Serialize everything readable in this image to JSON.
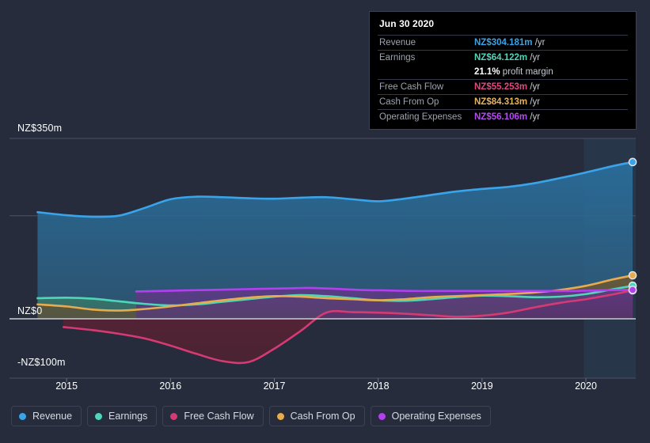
{
  "tooltip": {
    "date": "Jun 30 2020",
    "rows": [
      {
        "key": "Revenue",
        "value": "NZ$304.181m",
        "unit": "/yr",
        "color": "#3aa4ea"
      },
      {
        "key": "Earnings",
        "value": "NZ$64.122m",
        "unit": "/yr",
        "color": "#4fd6b8"
      },
      {
        "key": "",
        "value": "21.1%",
        "unit": "profit margin",
        "color": "#ffffff"
      },
      {
        "key": "Free Cash Flow",
        "value": "NZ$55.253m",
        "unit": "/yr",
        "color": "#e0487f"
      },
      {
        "key": "Cash From Op",
        "value": "NZ$84.313m",
        "unit": "/yr",
        "color": "#e8b45a"
      },
      {
        "key": "Operating Expenses",
        "value": "NZ$56.106m",
        "unit": "/yr",
        "color": "#b44bf0"
      }
    ]
  },
  "legend": {
    "items": [
      {
        "label": "Revenue",
        "color": "#3aa4ea"
      },
      {
        "label": "Earnings",
        "color": "#4fd6b8"
      },
      {
        "label": "Free Cash Flow",
        "color": "#d63a74"
      },
      {
        "label": "Cash From Op",
        "color": "#e8ab4e"
      },
      {
        "label": "Operating Expenses",
        "color": "#b33ff0"
      }
    ]
  },
  "chart_data": {
    "type": "area",
    "title": "",
    "xlabel": "",
    "ylabel": "",
    "currency": "NZ$",
    "units": "millions per year",
    "grid": true,
    "legend_position": "bottom-left",
    "ylim": [
      -100,
      350
    ],
    "ytick_labels": [
      "NZ$350m",
      "NZ$0",
      "-NZ$100m"
    ],
    "ytick_values": [
      350,
      0,
      -100
    ],
    "gridline_values": [
      350,
      200,
      0,
      -100
    ],
    "xtick_labels": [
      "2015",
      "2016",
      "2017",
      "2018",
      "2019",
      "2020"
    ],
    "xlim": [
      2014.45,
      2020.48
    ],
    "highlight_band": {
      "from": 2019.98,
      "to": 2020.48,
      "label": "forecast-period"
    },
    "series": [
      {
        "name": "Revenue",
        "color": "#3aa4ea",
        "fill": "#1d5580",
        "x": [
          2014.72,
          2015.0,
          2015.25,
          2015.5,
          2015.75,
          2016.0,
          2016.25,
          2016.5,
          2016.75,
          2017.0,
          2017.25,
          2017.5,
          2017.75,
          2018.0,
          2018.25,
          2018.5,
          2018.75,
          2019.0,
          2019.25,
          2019.5,
          2019.75,
          2020.0,
          2020.25,
          2020.45
        ],
        "y": [
          207,
          201,
          198,
          200,
          215,
          232,
          237,
          236,
          234,
          233,
          235,
          236,
          232,
          228,
          233,
          240,
          247,
          252,
          256,
          263,
          273,
          284,
          296,
          304.181
        ]
      },
      {
        "name": "Earnings",
        "color": "#4fd6b8",
        "fill": "#2e7a6c",
        "x": [
          2014.72,
          2015.0,
          2015.25,
          2015.5,
          2015.75,
          2016.0,
          2016.25,
          2016.5,
          2016.75,
          2017.0,
          2017.25,
          2017.5,
          2017.75,
          2018.0,
          2018.25,
          2018.5,
          2018.75,
          2019.0,
          2019.25,
          2019.5,
          2019.75,
          2020.0,
          2020.25,
          2020.45
        ],
        "y": [
          40,
          41,
          39,
          34,
          29,
          26,
          28,
          33,
          38,
          43,
          46,
          44,
          40,
          36,
          35,
          38,
          42,
          45,
          44,
          42,
          43,
          48,
          57,
          64.122
        ]
      },
      {
        "name": "Free Cash Flow",
        "color": "#d63a74",
        "fill": "#5c2437",
        "x": [
          2014.97,
          2015.25,
          2015.5,
          2015.75,
          2016.0,
          2016.25,
          2016.5,
          2016.75,
          2017.0,
          2017.25,
          2017.5,
          2017.75,
          2018.0,
          2018.25,
          2018.5,
          2018.75,
          2019.0,
          2019.25,
          2019.5,
          2019.75,
          2020.0,
          2020.25,
          2020.45
        ],
        "y": [
          -16,
          -22,
          -29,
          -38,
          -52,
          -68,
          -82,
          -84,
          -58,
          -24,
          12,
          13,
          12,
          10,
          7,
          4,
          6,
          12,
          22,
          31,
          38,
          47,
          55.253
        ]
      },
      {
        "name": "Cash From Op",
        "color": "#e8ab4e",
        "fill": "#6d5a3a",
        "x": [
          2014.72,
          2015.0,
          2015.25,
          2015.5,
          2015.75,
          2016.0,
          2016.25,
          2016.5,
          2016.75,
          2017.0,
          2017.25,
          2017.5,
          2017.75,
          2018.0,
          2018.25,
          2018.5,
          2018.75,
          2019.0,
          2019.25,
          2019.5,
          2019.75,
          2020.0,
          2020.25,
          2020.45
        ],
        "y": [
          28,
          24,
          18,
          16,
          19,
          24,
          30,
          36,
          41,
          44,
          43,
          40,
          38,
          36,
          38,
          42,
          44,
          46,
          48,
          51,
          56,
          64,
          76,
          84.313
        ]
      },
      {
        "name": "Operating Expenses",
        "color": "#b33ff0",
        "fill": "#5c3a80",
        "x": [
          2015.67,
          2015.9,
          2016.1,
          2016.35,
          2016.6,
          2016.85,
          2017.1,
          2017.35,
          2017.6,
          2017.85,
          2018.1,
          2018.35,
          2018.6,
          2018.85,
          2019.1,
          2019.35,
          2019.6,
          2019.85,
          2020.1,
          2020.3,
          2020.45
        ],
        "y": [
          53,
          54,
          55,
          56,
          57,
          58,
          59,
          60,
          58,
          56,
          55,
          54,
          54,
          54,
          54,
          54,
          54,
          54,
          55,
          56,
          56.106
        ]
      }
    ]
  }
}
